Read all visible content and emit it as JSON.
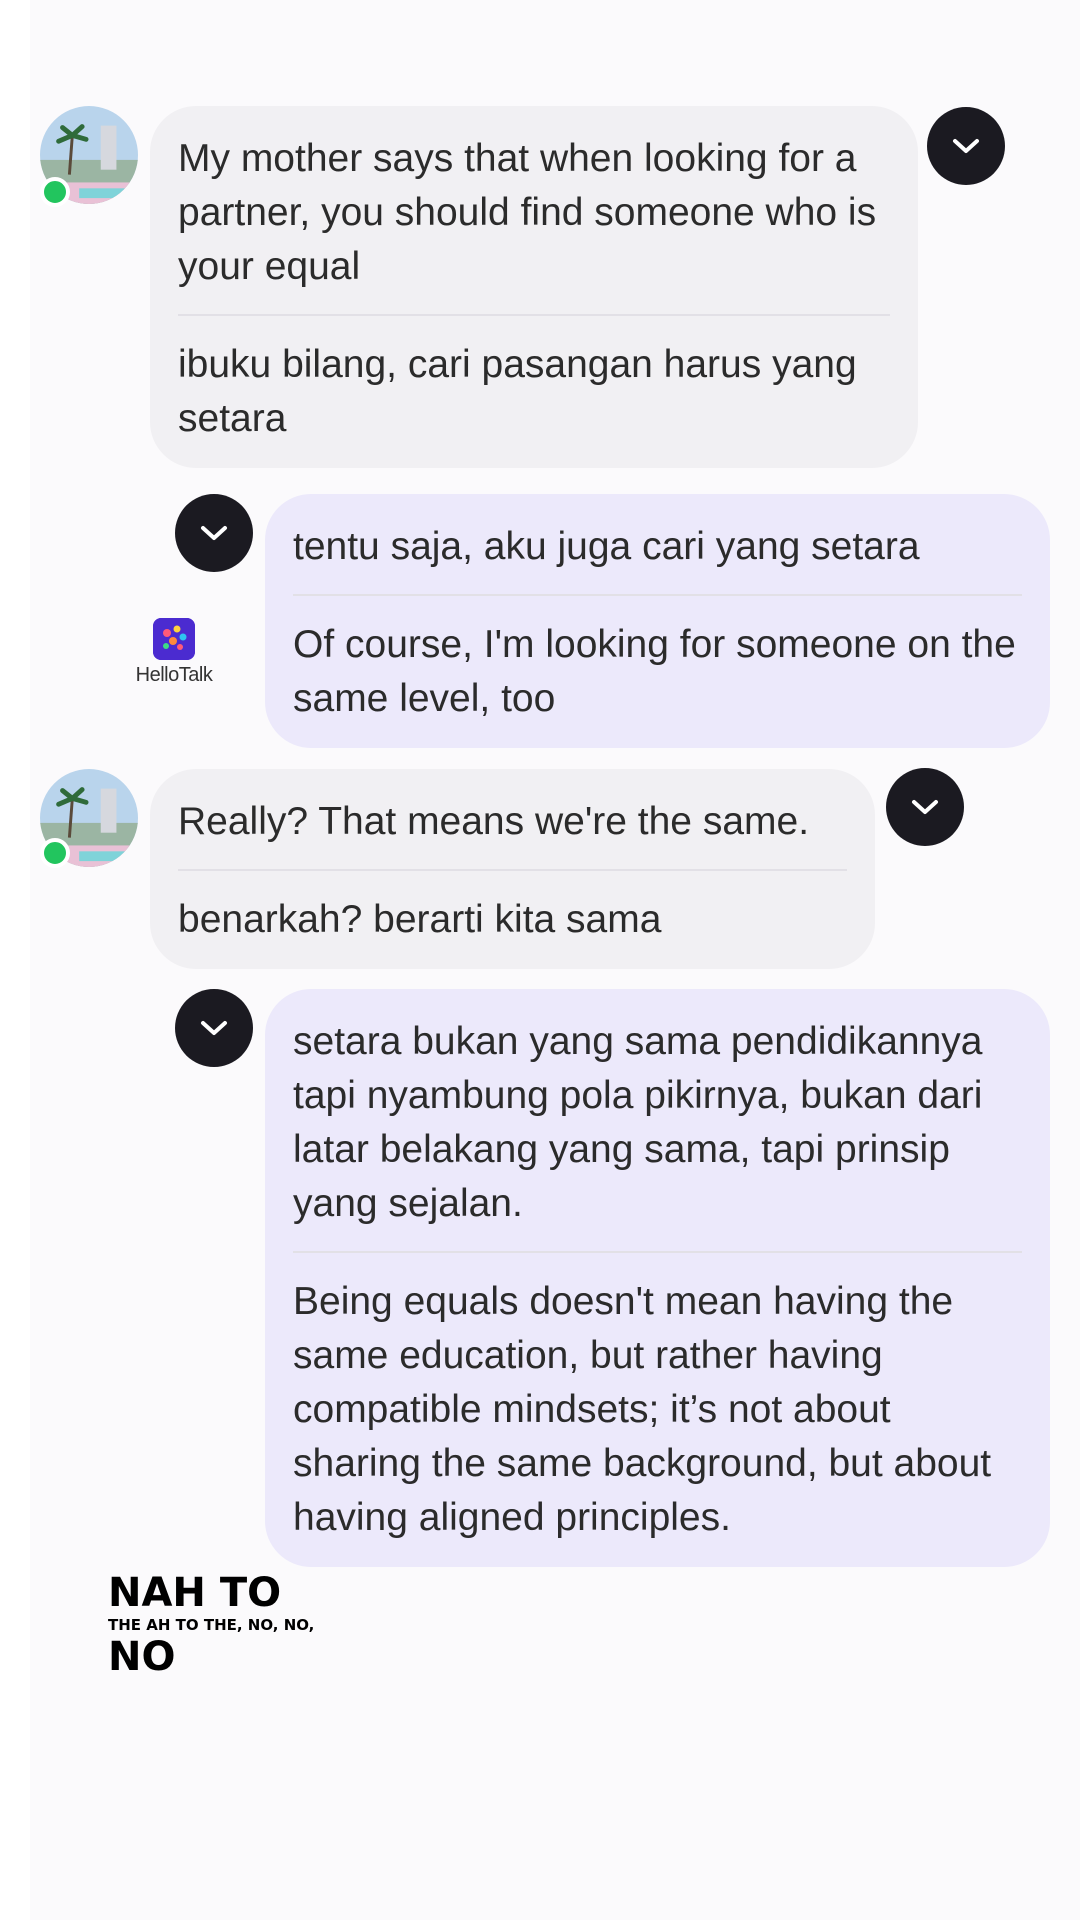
{
  "messages": [
    {
      "direction": "incoming",
      "primary": "My mother says that when looking for a partner, you should find someone who is your equal",
      "secondary": "ibuku bilang, cari pasangan harus yang setara"
    },
    {
      "direction": "outgoing",
      "primary": "tentu saja, aku juga cari yang setara",
      "secondary": "Of course, I'm looking for someone on the same level, too"
    },
    {
      "direction": "incoming",
      "primary": "Really? That means we're the same.",
      "secondary": "benarkah? berarti kita sama"
    },
    {
      "direction": "outgoing",
      "primary": "setara bukan yang sama pendidikannya tapi nyambung pola pikirnya, bukan dari latar belakang yang sama, tapi prinsip yang sejalan.",
      "secondary": "Being equals doesn't mean having the same education, but rather having compatible mindsets; it’s not about sharing the same background, but about having aligned principles."
    }
  ],
  "watermark": {
    "text": "HelloTalk",
    "icon": "hellotalk-logo-icon"
  },
  "caption": {
    "line1": "NAH TO",
    "line2": "THE AH TO THE, NO, NO,",
    "line3": "NO"
  },
  "icons": {
    "expand": "chevron-down-icon",
    "presence": "online-status-dot"
  },
  "colors": {
    "incoming_bubble": "#f1f0f3",
    "outgoing_bubble": "#ece9fb",
    "chevron_button": "#1b1a21",
    "online": "#22c55e"
  }
}
